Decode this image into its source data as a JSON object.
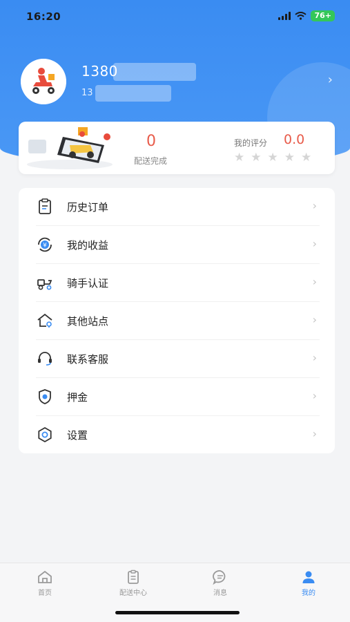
{
  "status_bar": {
    "time": "16:20",
    "battery": "76+"
  },
  "profile": {
    "phone": "1380",
    "sub": "13"
  },
  "stats": {
    "delivered_count": "0",
    "delivered_label": "配送完成",
    "rating_label": "我的评分",
    "rating_value": "0.0",
    "stars_filled": 0,
    "stars_total": 5
  },
  "menu": {
    "items": [
      {
        "label": "历史订单",
        "icon": "order-history-icon"
      },
      {
        "label": "我的收益",
        "icon": "earnings-icon"
      },
      {
        "label": "骑手认证",
        "icon": "rider-certification-icon"
      },
      {
        "label": "其他站点",
        "icon": "other-stations-icon"
      },
      {
        "label": "联系客服",
        "icon": "customer-service-icon"
      },
      {
        "label": "押金",
        "icon": "deposit-icon"
      },
      {
        "label": "设置",
        "icon": "settings-icon"
      }
    ]
  },
  "tabbar": {
    "tabs": [
      {
        "label": "首页",
        "icon": "home-icon"
      },
      {
        "label": "配送中心",
        "icon": "delivery-center-icon"
      },
      {
        "label": "消息",
        "icon": "message-icon"
      },
      {
        "label": "我的",
        "icon": "profile-icon"
      }
    ],
    "active_index": 3
  },
  "colors": {
    "primary": "#3a8cf2",
    "accent": "#e85b4a",
    "success": "#34c759"
  }
}
